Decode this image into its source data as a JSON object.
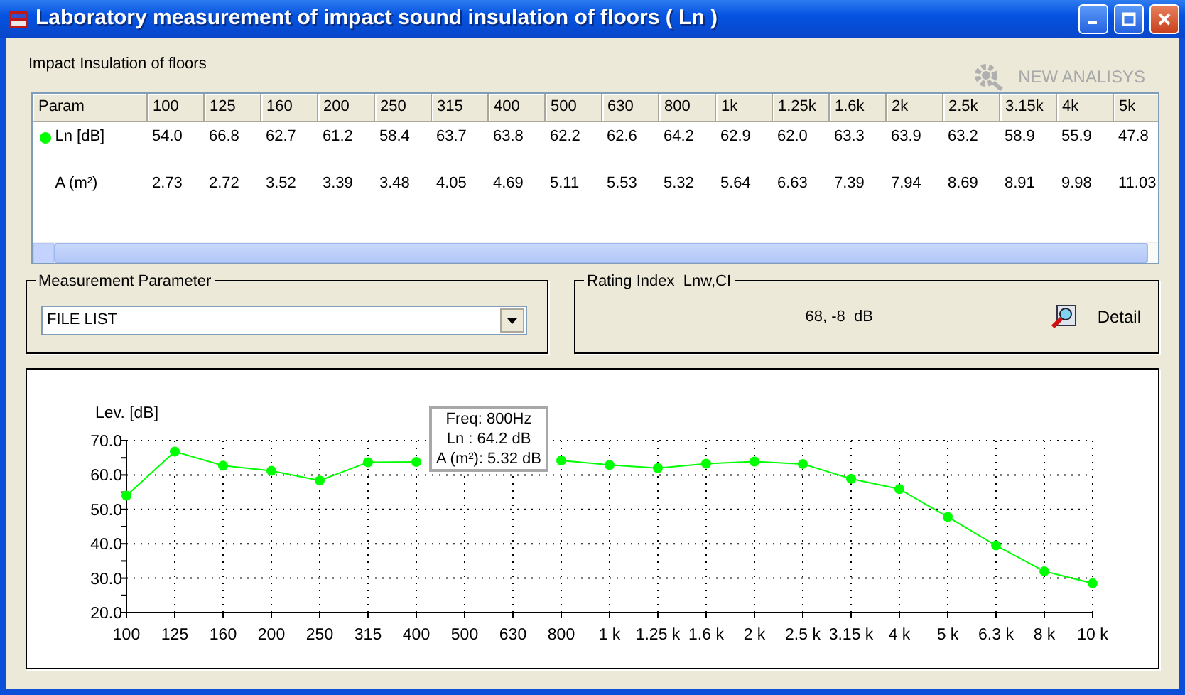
{
  "window": {
    "title": "Laboratory measurement of impact sound insulation of floors ( Ln )"
  },
  "header": {
    "title": "Impact Insulation of floors",
    "new_analysis": {
      "label": "NEW ANALISYS",
      "disabled": true
    }
  },
  "table": {
    "columns": [
      "Param",
      "100",
      "125",
      "160",
      "200",
      "250",
      "315",
      "400",
      "500",
      "630",
      "800",
      "1k",
      "1.25k",
      "1.6k",
      "2k",
      "2.5k",
      "3.15k",
      "4k",
      "5k"
    ],
    "rows": [
      {
        "label": "Ln [dB]",
        "color": "#00ff00",
        "values": [
          "54.0",
          "66.8",
          "62.7",
          "61.2",
          "58.4",
          "63.7",
          "63.8",
          "62.2",
          "62.6",
          "64.2",
          "62.9",
          "62.0",
          "63.3",
          "63.9",
          "63.2",
          "58.9",
          "55.9",
          "47.8"
        ]
      },
      {
        "label": "A (m²)",
        "values": [
          "2.73",
          "2.72",
          "3.52",
          "3.39",
          "3.48",
          "4.05",
          "4.69",
          "5.11",
          "5.53",
          "5.32",
          "5.64",
          "6.63",
          "7.39",
          "7.94",
          "8.69",
          "8.91",
          "9.98",
          "11.03"
        ]
      }
    ]
  },
  "measurement_parameter": {
    "title": "Measurement Parameter",
    "value": "FILE LIST"
  },
  "rating_index": {
    "title": "Rating Index  Lnw,CI",
    "value": "68, -8  dB",
    "detail": "Detail"
  },
  "chart": {
    "tooltip": [
      "Freq: 800Hz",
      "Ln : 64.2 dB",
      "A (m²): 5.32 dB"
    ],
    "chart_data": {
      "type": "line",
      "ylabel": "Lev. [dB]",
      "categories": [
        "100",
        "125",
        "160",
        "200",
        "250",
        "315",
        "400",
        "500",
        "630",
        "800",
        "1 k",
        "1.25 k",
        "1.6 k",
        "2 k",
        "2.5 k",
        "3.15 k",
        "4 k",
        "5 k",
        "6.3 k",
        "8 k",
        "10 k"
      ],
      "grid": true,
      "series": [
        {
          "color": "#00ff00",
          "marker": "circle",
          "values": [
            54.0,
            66.8,
            62.7,
            61.2,
            58.4,
            63.7,
            63.8,
            null,
            null,
            64.2,
            62.9,
            62.0,
            63.3,
            63.9,
            63.2,
            58.9,
            55.9,
            47.8,
            39.5,
            32.0,
            28.5
          ]
        }
      ],
      "ylim": [
        20,
        70
      ],
      "yticks": [
        {
          "value": 20,
          "label": "20.0"
        },
        {
          "value": 30,
          "label": "30.0"
        },
        {
          "value": 40,
          "label": "40.0"
        },
        {
          "value": 50,
          "label": "50.0"
        },
        {
          "value": 60,
          "label": "60.0"
        },
        {
          "value": 70,
          "label": "70.0"
        }
      ]
    }
  }
}
